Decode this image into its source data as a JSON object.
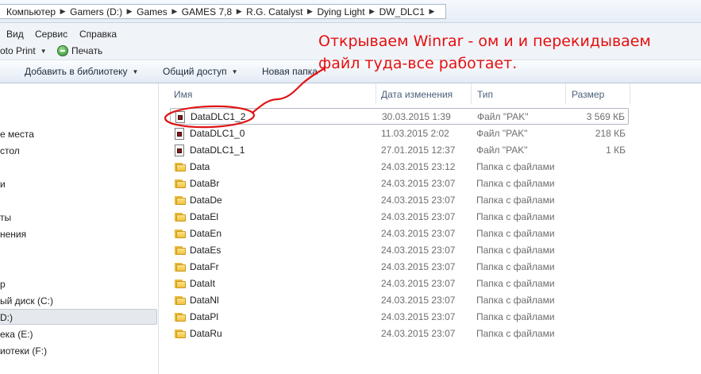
{
  "breadcrumb": {
    "items": [
      "Компьютер",
      "Gamers (D:)",
      "Games",
      "GAMES 7,8",
      "R.G. Catalyst",
      "Dying Light",
      "DW_DLC1"
    ]
  },
  "menubar": {
    "view": "Вид",
    "service": "Сервис",
    "help": "Справка"
  },
  "printbar": {
    "photo_print": "oto Print",
    "print": "Печать"
  },
  "toolbar": {
    "add_to_library": "Добавить в библиотеку",
    "share": "Общий доступ",
    "new_folder": "Новая папка"
  },
  "nav": {
    "items": [
      "е места",
      "стол",
      "и",
      "ты",
      "нения",
      "р",
      "ый диск (C:)",
      "D:)",
      "ека (E:)",
      "иотеки (F:)"
    ]
  },
  "columns": {
    "name": "Имя",
    "date": "Дата изменения",
    "type": "Тип",
    "size": "Размер"
  },
  "files": [
    {
      "name": "DataDLC1_2",
      "date": "30.03.2015 1:39",
      "type": "Файл \"PAK\"",
      "size": "3 569 КБ",
      "kind": "file"
    },
    {
      "name": "DataDLC1_0",
      "date": "11.03.2015 2:02",
      "type": "Файл \"PAK\"",
      "size": "218 КБ",
      "kind": "file"
    },
    {
      "name": "DataDLC1_1",
      "date": "27.01.2015 12:37",
      "type": "Файл \"PAK\"",
      "size": "1 КБ",
      "kind": "file"
    },
    {
      "name": "Data",
      "date": "24.03.2015 23:12",
      "type": "Папка с файлами",
      "size": "",
      "kind": "folder"
    },
    {
      "name": "DataBr",
      "date": "24.03.2015 23:07",
      "type": "Папка с файлами",
      "size": "",
      "kind": "folder"
    },
    {
      "name": "DataDe",
      "date": "24.03.2015 23:07",
      "type": "Папка с файлами",
      "size": "",
      "kind": "folder"
    },
    {
      "name": "DataEl",
      "date": "24.03.2015 23:07",
      "type": "Папка с файлами",
      "size": "",
      "kind": "folder"
    },
    {
      "name": "DataEn",
      "date": "24.03.2015 23:07",
      "type": "Папка с файлами",
      "size": "",
      "kind": "folder"
    },
    {
      "name": "DataEs",
      "date": "24.03.2015 23:07",
      "type": "Папка с файлами",
      "size": "",
      "kind": "folder"
    },
    {
      "name": "DataFr",
      "date": "24.03.2015 23:07",
      "type": "Папка с файлами",
      "size": "",
      "kind": "folder"
    },
    {
      "name": "DataIt",
      "date": "24.03.2015 23:07",
      "type": "Папка с файлами",
      "size": "",
      "kind": "folder"
    },
    {
      "name": "DataNl",
      "date": "24.03.2015 23:07",
      "type": "Папка с файлами",
      "size": "",
      "kind": "folder"
    },
    {
      "name": "DataPl",
      "date": "24.03.2015 23:07",
      "type": "Папка с файлами",
      "size": "",
      "kind": "folder"
    },
    {
      "name": "DataRu",
      "date": "24.03.2015 23:07",
      "type": "Папка с файлами",
      "size": "",
      "kind": "folder"
    }
  ],
  "annotation": {
    "line1": "Открываем Winrar - ом и и перекидываем",
    "line2": "файл туда-все работает.",
    "color": "#e60f0f"
  }
}
